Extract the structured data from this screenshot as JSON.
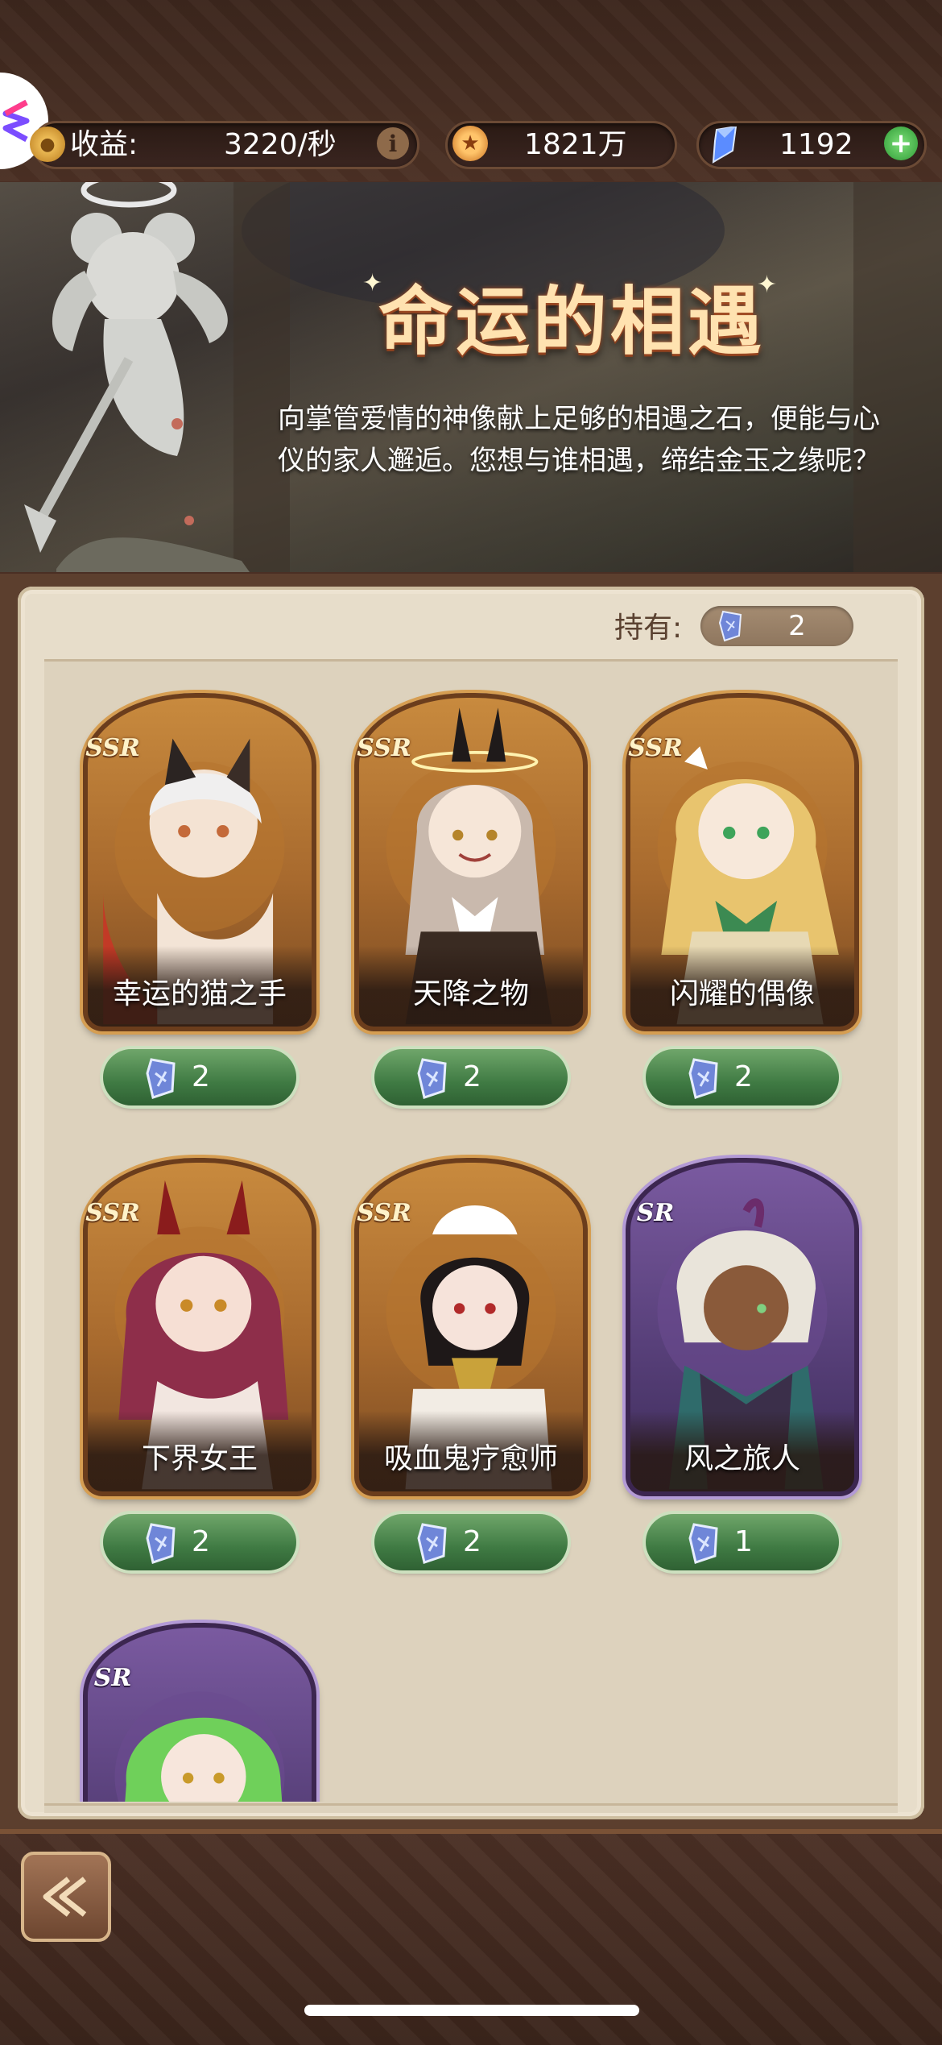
{
  "header": {
    "income_label": "收益:",
    "income_value": "3220/秒",
    "gold_value": "1821万",
    "gem_value": "1192"
  },
  "banner": {
    "title": "命运的相遇",
    "description": "向掌管爱情的神像献上足够的相遇之石，便能与心仪的家人邂逅。您想与谁相遇，缔结金玉之缘呢？"
  },
  "held": {
    "label": "持有:",
    "value": "2"
  },
  "cards": [
    {
      "name": "幸运的猫之手",
      "rarity": "SSR",
      "cost": "2"
    },
    {
      "name": "天降之物",
      "rarity": "SSR",
      "cost": "2"
    },
    {
      "name": "闪耀的偶像",
      "rarity": "SSR",
      "cost": "2"
    },
    {
      "name": "下界女王",
      "rarity": "SSR",
      "cost": "2"
    },
    {
      "name": "吸血鬼疗愈师",
      "rarity": "SSR",
      "cost": "2"
    },
    {
      "name": "风之旅人",
      "rarity": "SR",
      "cost": "1"
    },
    {
      "name": "",
      "rarity": "SR",
      "cost": ""
    }
  ],
  "colors": {
    "frame_brown": "#5c3f2e",
    "panel_cream": "#e7ddca",
    "cost_green": "#3f7a43",
    "ssr_gold": "#c88a3e",
    "sr_purple": "#58407a",
    "gem_blue": "#6aa6ff"
  },
  "icons": {
    "income": "coin-stack-icon",
    "info": "info-icon",
    "gold": "gold-coin-icon",
    "gem": "blue-crystal-icon",
    "add": "plus-icon",
    "stone": "encounter-stone-icon",
    "back": "back-arrow-icon"
  }
}
